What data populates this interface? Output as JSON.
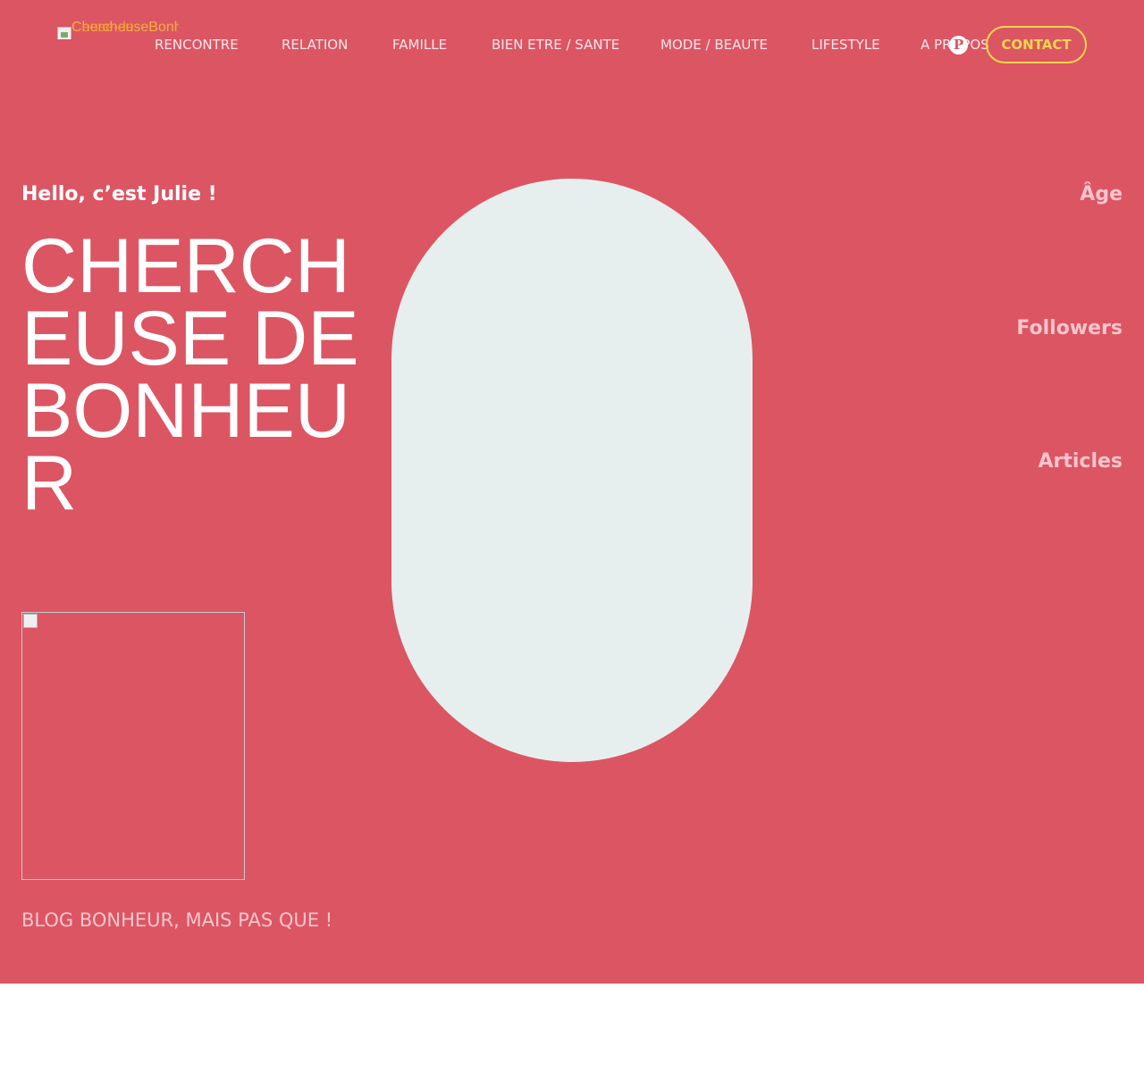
{
  "brand": {
    "logo_alt_a": "ChercheuseBonh",
    "logo_alt_b": "euse-de"
  },
  "nav": {
    "items": [
      {
        "label": "RENCONTRE"
      },
      {
        "label": "RELATION"
      },
      {
        "label": "FAMILLE"
      },
      {
        "label": "BIEN ETRE / SANTE"
      },
      {
        "label": "MODE / BEAUTE"
      },
      {
        "label": "LIFESTYLE"
      },
      {
        "label": "A PROPOS"
      }
    ],
    "social_icon": "pinterest-icon",
    "contact_label": "CONTACT"
  },
  "hero": {
    "greeting": "Hello, c’est Julie !",
    "title": "CHERCHEUSE DE BONHEUR",
    "tagline": "BLOG BONHEUR, MAIS PAS QUE !"
  },
  "stats": {
    "age_label": "Âge",
    "followers_label": "Followers",
    "articles_label": "Articles"
  },
  "colors": {
    "hero_bg": "#dc5563",
    "accent": "#f5d648",
    "pill": "#e6efee"
  }
}
